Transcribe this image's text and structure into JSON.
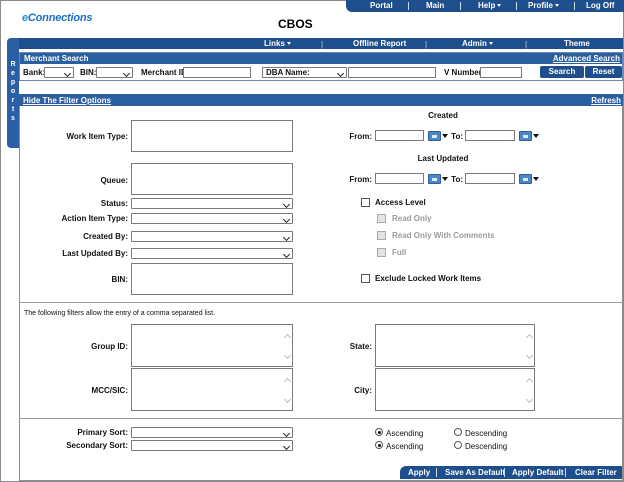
{
  "logo": {
    "prefix": "e",
    "text": "Connections"
  },
  "app_title": "CBOS",
  "topnav": {
    "portal": "Portal",
    "main": "Main",
    "help": "Help",
    "profile": "Profile",
    "logoff": "Log Off"
  },
  "sidetab": {
    "letters": [
      "R",
      "e",
      "p",
      "o",
      "r",
      "t",
      "s"
    ]
  },
  "nav2": {
    "links": "Links",
    "offline_report": "Offline Report",
    "admin": "Admin",
    "theme": "Theme"
  },
  "merchant_search": {
    "title": "Merchant Search",
    "advanced": "Advanced Search",
    "bank_label": "Bank:",
    "bin_label": "BIN:",
    "merchant_id_label": "Merchant ID:",
    "dba_label": "DBA Name:",
    "v_number_label": "V Number:",
    "search_button": "Search",
    "reset_button": "Reset"
  },
  "filter_bar": {
    "hide": "Hide The Filter Options",
    "refresh": "Refresh"
  },
  "filters": {
    "work_item_type": "Work Item Type:",
    "queue": "Queue:",
    "status": "Status:",
    "action_item_type": "Action Item Type:",
    "created_by": "Created By:",
    "last_updated_by": "Last Updated By:",
    "bin": "BIN:",
    "created_header": "Created",
    "last_updated_header": "Last Updated",
    "from": "From:",
    "to": "To:",
    "access_level": "Access Level",
    "read_only": "Read Only",
    "read_only_comments": "Read Only With Comments",
    "full": "Full",
    "exclude_locked": "Exclude Locked Work Items"
  },
  "comma_note": "The following filters allow the entry of a comma separated list.",
  "list_filters": {
    "group_id": "Group ID:",
    "state": "State:",
    "mcc_sic": "MCC/SIC:",
    "city": "City:"
  },
  "sort": {
    "primary": "Primary Sort:",
    "secondary": "Secondary Sort:",
    "ascending": "Ascending",
    "descending": "Descending"
  },
  "bottom_buttons": {
    "apply": "Apply",
    "save_default": "Save As Default",
    "apply_default": "Apply Default",
    "clear_filter": "Clear Filter"
  }
}
